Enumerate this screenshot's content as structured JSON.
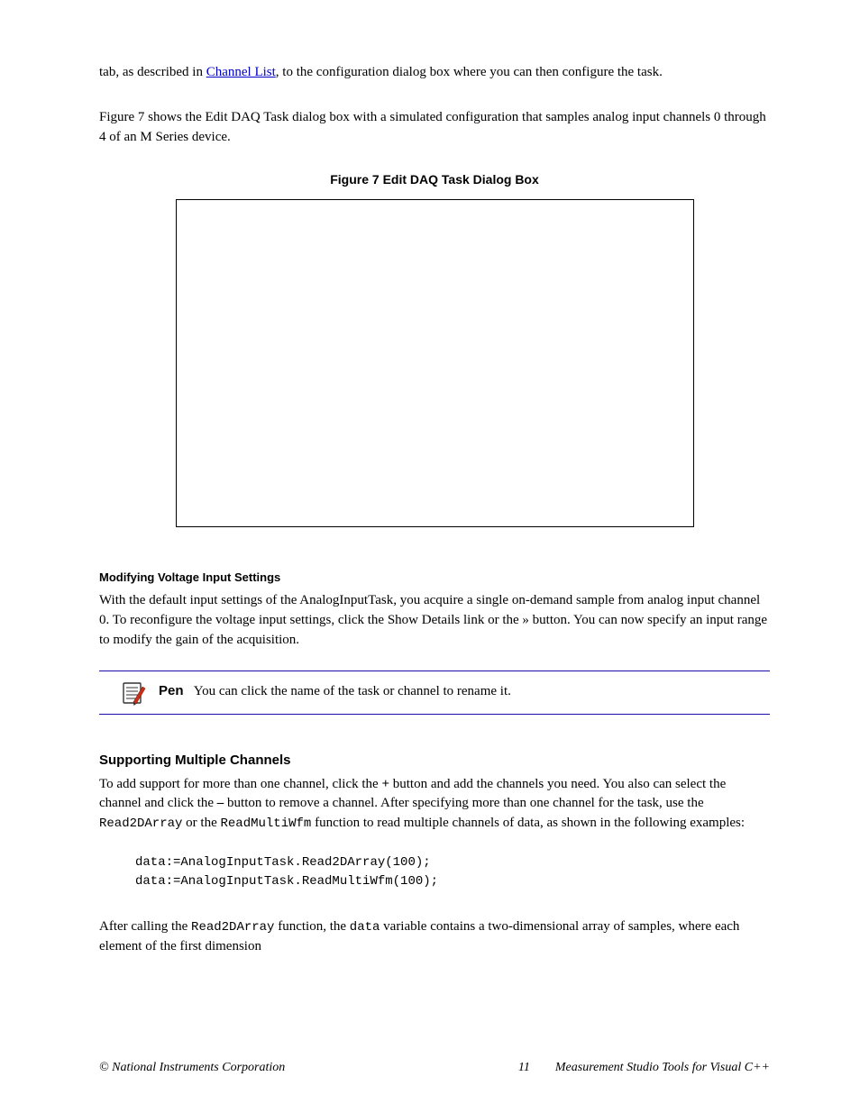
{
  "intro": {
    "line1_prefix": "tab, as described in ",
    "link_text": "Channel List",
    "line1_suffix": ", to the configuration dialog box where you can then configure the task.",
    "para2": "Figure 7 shows the Edit DAQ Task dialog box with a simulated configuration that samples analog input channels 0 through 4 of an M Series device."
  },
  "figure": {
    "title": "Figure 7  Edit DAQ Task Dialog Box",
    "caption_label": "Modifying Voltage Input Settings",
    "caption_text": "With the default input settings of the AnalogInputTask, you acquire a single on-demand sample from analog input channel 0. To reconfigure the voltage input settings, click the Show Details link or the » button. You can now specify an input range to modify the gain of the acquisition."
  },
  "callout": {
    "pen_label": "Pen",
    "text": "You can click the name of the task or channel to rename it."
  },
  "section1": {
    "heading": "Supporting Multiple Channels",
    "para1_a": "To add support for more than one channel, click the ",
    "para1_plus": "+",
    "para1_b": " button and add the channels you need. You also can select the channel and click the ",
    "para1_minus": "–",
    "para1_c": " button to remove a channel. After specifying more than one channel for the task, use the ",
    "code1": "Read2DArray",
    "para1_d": " or the ",
    "code2": "ReadMultiWfm",
    "para1_e": " function to read multiple channels of data, as shown in the following examples:",
    "codeblock": "data:=AnalogInputTask.Read2DArray(100);\ndata:=AnalogInputTask.ReadMultiWfm(100);",
    "para2_a": "After calling the ",
    "code3": "Read2DArray",
    "para2_b": " function, the ",
    "code4": "data",
    "para2_c": " variable contains a two-dimensional array of samples, where each element of the first dimension"
  },
  "footer": {
    "copyright": "© National Instruments Corporation",
    "page": "11",
    "doc": "Measurement Studio Tools for Visual C++"
  }
}
